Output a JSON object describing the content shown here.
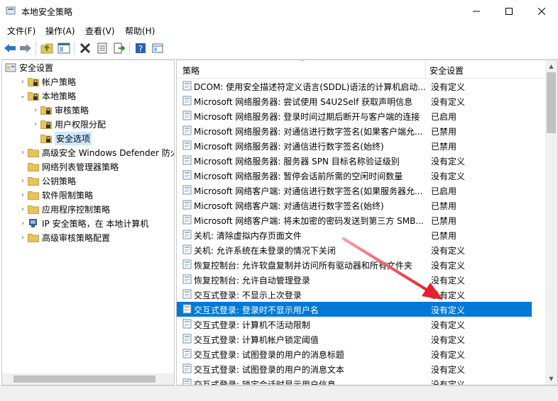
{
  "window": {
    "title": "本地安全策略"
  },
  "menu": [
    "文件(F)",
    "操作(A)",
    "查看(V)",
    "帮助(H)"
  ],
  "toolbar": [
    "back-icon",
    "forward-icon",
    "up-folder-icon",
    "show-tree-icon",
    "delete-icon",
    "properties-icon",
    "export-icon",
    "help-icon",
    "view-icon"
  ],
  "tree": [
    {
      "label": "安全设置",
      "level": 0,
      "expander": "",
      "icon": "security-settings-icon"
    },
    {
      "label": "帐户策略",
      "level": 1,
      "expander": ">",
      "icon": "folder-lock-icon"
    },
    {
      "label": "本地策略",
      "level": 1,
      "expander": "v",
      "icon": "folder-lock-icon"
    },
    {
      "label": "审核策略",
      "level": 2,
      "expander": ">",
      "icon": "folder-lock-icon"
    },
    {
      "label": "用户权限分配",
      "level": 2,
      "expander": ">",
      "icon": "folder-lock-icon"
    },
    {
      "label": "安全选项",
      "level": 2,
      "expander": "",
      "icon": "folder-lock-icon",
      "selected": true
    },
    {
      "label": "高级安全 Windows Defender 防火墙",
      "level": 1,
      "expander": ">",
      "icon": "folder-icon"
    },
    {
      "label": "网络列表管理器策略",
      "level": 1,
      "expander": "",
      "icon": "folder-icon"
    },
    {
      "label": "公钥策略",
      "level": 1,
      "expander": ">",
      "icon": "folder-icon"
    },
    {
      "label": "软件限制策略",
      "level": 1,
      "expander": ">",
      "icon": "folder-icon"
    },
    {
      "label": "应用程序控制策略",
      "level": 1,
      "expander": ">",
      "icon": "folder-icon"
    },
    {
      "label": "IP 安全策略，在 本地计算机",
      "level": 1,
      "expander": ">",
      "icon": "ip-security-icon"
    },
    {
      "label": "高级审核策略配置",
      "level": 1,
      "expander": ">",
      "icon": "folder-icon"
    }
  ],
  "list": {
    "headers": {
      "policy": "策略",
      "setting": "安全设置"
    },
    "rows": [
      {
        "policy": "DCOM: 使用安全描述符定义语言(SDDL)语法的计算机启动...",
        "setting": "没有定义"
      },
      {
        "policy": "Microsoft 网络服务器: 尝试使用 S4U2Self 获取声明信息",
        "setting": "没有定义"
      },
      {
        "policy": "Microsoft 网络服务器: 登录时间过期后断开与客户端的连接",
        "setting": "已启用"
      },
      {
        "policy": "Microsoft 网络服务器: 对通信进行数字签名(如果客户端允...",
        "setting": "已禁用"
      },
      {
        "policy": "Microsoft 网络服务器: 对通信进行数字签名(始终)",
        "setting": "已禁用"
      },
      {
        "policy": "Microsoft 网络服务器: 服务器 SPN 目标名称验证级别",
        "setting": "没有定义"
      },
      {
        "policy": "Microsoft 网络服务器: 暂停会话前所需的空闲时间数量",
        "setting": "没有定义"
      },
      {
        "policy": "Microsoft 网络客户端: 对通信进行数字签名(如果服务器允...",
        "setting": "已启用"
      },
      {
        "policy": "Microsoft 网络客户端: 对通信进行数字签名(始终)",
        "setting": "已禁用"
      },
      {
        "policy": "Microsoft 网络客户端: 将未加密的密码发送到第三方 SMB...",
        "setting": "已禁用"
      },
      {
        "policy": "关机: 清除虚拟内存页面文件",
        "setting": "已禁用"
      },
      {
        "policy": "关机: 允许系统在未登录的情况下关闭",
        "setting": "没有定义"
      },
      {
        "policy": "恢复控制台: 允许软盘复制并访问所有驱动器和所有文件夹",
        "setting": "没有定义"
      },
      {
        "policy": "恢复控制台: 允许自动管理登录",
        "setting": "没有定义"
      },
      {
        "policy": "交互式登录: 不显示上次登录",
        "setting": "没有定义"
      },
      {
        "policy": "交互式登录: 登录时不显示用户名",
        "setting": "没有定义",
        "selected": true
      },
      {
        "policy": "交互式登录: 计算机不活动限制",
        "setting": "没有定义"
      },
      {
        "policy": "交互式登录: 计算机帐户锁定阈值",
        "setting": "没有定义"
      },
      {
        "policy": "交互式登录: 试图登录的用户的消息标题",
        "setting": "没有定义"
      },
      {
        "policy": "交互式登录: 试图登录的用户的消息文本",
        "setting": "没有定义"
      },
      {
        "policy": "交互式登录: 锁定会话时显示用户信息",
        "setting": "没有定义"
      }
    ]
  },
  "colors": {
    "selection": "#0078d7",
    "tree_selection": "#cce8ff",
    "annotation_arrow": "#e8202a",
    "folder": "#e8c25a"
  }
}
